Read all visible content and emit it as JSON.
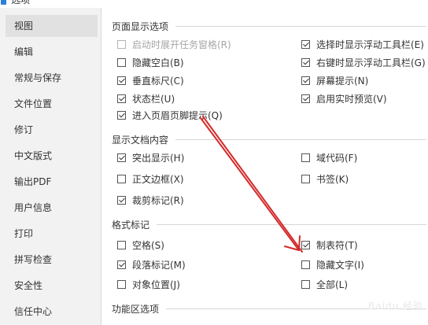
{
  "window": {
    "title": "选项"
  },
  "sidebar": {
    "items": [
      {
        "label": "视图",
        "active": true
      },
      {
        "label": "编辑"
      },
      {
        "label": "常规与保存"
      },
      {
        "label": "文件位置"
      },
      {
        "label": "修订"
      },
      {
        "label": "中文版式"
      },
      {
        "label": "输出PDF"
      },
      {
        "label": "用户信息"
      },
      {
        "label": "打印"
      },
      {
        "label": "拼写检查"
      },
      {
        "label": "安全性"
      },
      {
        "label": "信任中心"
      }
    ]
  },
  "groups": {
    "page": {
      "title": "页面显示选项",
      "options": [
        {
          "label": "启动时展开任务窗格(R)",
          "checked": false,
          "disabled": true
        },
        {
          "label": "选择时显示浮动工具栏(E)",
          "checked": true
        },
        {
          "label": "隐藏空白(B)",
          "checked": false
        },
        {
          "label": "右键时显示浮动工具栏(G)",
          "checked": true
        },
        {
          "label": "垂直标尺(C)",
          "checked": true
        },
        {
          "label": "屏幕提示(N)",
          "checked": true
        },
        {
          "label": "状态栏(U)",
          "checked": true
        },
        {
          "label": "启用实时预览(V)",
          "checked": true
        },
        {
          "label": "进入页眉页脚提示(Q)",
          "checked": true
        }
      ]
    },
    "doc": {
      "title": "显示文档内容",
      "options": [
        {
          "label": "突出显示(H)",
          "checked": true
        },
        {
          "label": "域代码(F)",
          "checked": false
        },
        {
          "label": "正文边框(X)",
          "checked": false
        },
        {
          "label": "书签(K)",
          "checked": false
        },
        {
          "label": "裁剪标记(R)",
          "checked": true
        }
      ]
    },
    "marks": {
      "title": "格式标记",
      "options": [
        {
          "label": "空格(S)",
          "checked": false
        },
        {
          "label": "制表符(T)",
          "checked": true
        },
        {
          "label": "段落标记(M)",
          "checked": true
        },
        {
          "label": "隐藏文字(I)",
          "checked": false
        },
        {
          "label": "对象位置(J)",
          "checked": false
        },
        {
          "label": "全部(L)",
          "checked": false
        }
      ]
    },
    "ribbon": {
      "title": "功能区选项"
    }
  },
  "annotation": {
    "arrow_color": "#d42a2a"
  },
  "watermark": {
    "text": "Baidu 经验"
  }
}
